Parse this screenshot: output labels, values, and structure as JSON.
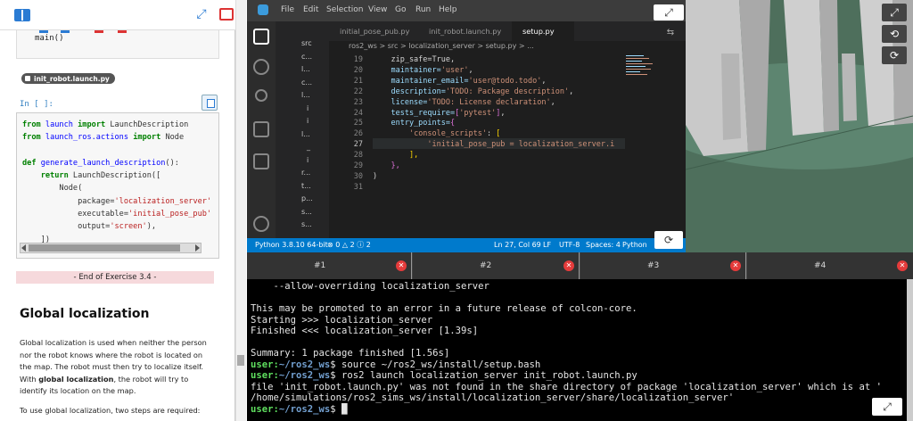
{
  "left_panel": {
    "top_icons": [
      "book-icon",
      "expand-icon",
      "slides-icon"
    ],
    "fragment_code": "main()",
    "file_tag": "init_robot.launch.py",
    "in_prompt": "In [ ]:",
    "code_lines": [
      [
        {
          "t": "from",
          "c": "kw"
        },
        {
          "t": " "
        },
        {
          "t": "launch",
          "c": "fn"
        },
        {
          "t": " "
        },
        {
          "t": "import",
          "c": "kw"
        },
        {
          "t": " LaunchDescription"
        }
      ],
      [
        {
          "t": "from",
          "c": "kw"
        },
        {
          "t": " "
        },
        {
          "t": "launch_ros.actions",
          "c": "fn"
        },
        {
          "t": " "
        },
        {
          "t": "import",
          "c": "kw"
        },
        {
          "t": " Node"
        }
      ],
      [
        {
          "t": ""
        }
      ],
      [
        {
          "t": "def",
          "c": "kw"
        },
        {
          "t": " "
        },
        {
          "t": "generate_launch_description",
          "c": "fn"
        },
        {
          "t": "():"
        }
      ],
      [
        {
          "t": "    "
        },
        {
          "t": "return",
          "c": "kw"
        },
        {
          "t": " LaunchDescription(["
        }
      ],
      [
        {
          "t": "        Node("
        }
      ],
      [
        {
          "t": "            package="
        },
        {
          "t": "'localization_server'",
          "c": "str"
        }
      ],
      [
        {
          "t": "            executable="
        },
        {
          "t": "'initial_pose_pub'",
          "c": "str"
        }
      ],
      [
        {
          "t": "            output="
        },
        {
          "t": "'screen'",
          "c": "str"
        },
        {
          "t": "),"
        }
      ],
      [
        {
          "t": "    ])"
        }
      ]
    ],
    "end_exercise": "- End of Exercise 3.4 -",
    "heading": "Global localization",
    "paragraph_parts": [
      "Global localization is used when neither the person nor the robot knows where the robot is located on the map. The robot must then try to localize itself. With ",
      "global localization",
      ", the robot will try to identify its location on the map."
    ],
    "paragraph2": "To use global localization, two steps are required:"
  },
  "vscode": {
    "menu": [
      "File",
      "Edit",
      "Selection",
      "View",
      "Go",
      "Run",
      "Help"
    ],
    "tabs": [
      "initial_pose_pub.py",
      "init_robot.launch.py",
      "setup.py"
    ],
    "active_tab": "setup.py",
    "breadcrumb": "ros2_ws  >  src  >  localization_server  >  setup.py  >  ...",
    "tree": [
      "src",
      "c...",
      "l...",
      "c...",
      "l...",
      "i",
      "i",
      "l...",
      "_",
      "i",
      "r...",
      "t...",
      "p...",
      "s...",
      "s..."
    ],
    "line_numbers": [
      "19",
      "20",
      "21",
      "22",
      "23",
      "24",
      "25",
      "26",
      "27",
      "28",
      "29",
      "30",
      "31"
    ],
    "current_line": "27",
    "code": [
      [
        {
          "t": "    zip_safe=True,",
          "c": "ep"
        }
      ],
      [
        {
          "t": "    maintainer="
        },
        {
          "t": "'user'",
          "c": "es"
        },
        {
          "t": ",",
          "c": "ep"
        }
      ],
      [
        {
          "t": "    maintainer_email="
        },
        {
          "t": "'user@todo.todo'",
          "c": "es"
        },
        {
          "t": ",",
          "c": "ep"
        }
      ],
      [
        {
          "t": "    description="
        },
        {
          "t": "'TODO: Package description'",
          "c": "es"
        },
        {
          "t": ",",
          "c": "ep"
        }
      ],
      [
        {
          "t": "    license="
        },
        {
          "t": "'TODO: License declaration'",
          "c": "es"
        },
        {
          "t": ",",
          "c": "ep"
        }
      ],
      [
        {
          "t": "    tests_require="
        },
        {
          "t": "[",
          "c": "eb"
        },
        {
          "t": "'pytest'",
          "c": "es"
        },
        {
          "t": "]",
          "c": "eb"
        },
        {
          "t": ",",
          "c": "ep"
        }
      ],
      [
        {
          "t": "    entry_points="
        },
        {
          "t": "{",
          "c": "eb"
        }
      ],
      [
        {
          "t": "        "
        },
        {
          "t": "'console_scripts'",
          "c": "es"
        },
        {
          "t": ": ",
          "c": "ep"
        },
        {
          "t": "[",
          "c": "ey"
        }
      ],
      [
        {
          "t": "            "
        },
        {
          "t": "'initial_pose_pub = localization_server.i",
          "c": "es"
        }
      ],
      [
        {
          "t": "        "
        },
        {
          "t": "],",
          "c": "ey"
        }
      ],
      [
        {
          "t": "    "
        },
        {
          "t": "},",
          "c": "eb"
        }
      ],
      [
        {
          "t": ")",
          "c": "ep"
        }
      ],
      [
        {
          "t": ""
        }
      ]
    ],
    "status": {
      "python": "Python 3.8.10 64-bit",
      "problems": "⊗ 0 △ 2 ⓘ 2",
      "position": "Ln 27, Col 69",
      "eol": "LF",
      "encoding": "UTF-8",
      "spaces": "Spaces: 4",
      "language": "Python"
    }
  },
  "terminal_tabs": [
    "#1",
    "#2",
    "#3",
    "#4"
  ],
  "terminal_lines": [
    [
      {
        "t": "    --allow-overriding localization_server"
      }
    ],
    [
      {
        "t": ""
      }
    ],
    [
      {
        "t": "This may be promoted to an error in a future release of colcon-core."
      }
    ],
    [
      {
        "t": "Starting >>> localization_server"
      }
    ],
    [
      {
        "t": "Finished <<< localization_server [1.39s]"
      }
    ],
    [
      {
        "t": ""
      }
    ],
    [
      {
        "t": "Summary: 1 package finished [1.56s]"
      }
    ],
    [
      {
        "t": "user:",
        "c": "tu"
      },
      {
        "t": "~/ros2_ws",
        "c": "tb"
      },
      {
        "t": "$ source ~/ros2_ws/install/setup.bash"
      }
    ],
    [
      {
        "t": "user:",
        "c": "tu"
      },
      {
        "t": "~/ros2_ws",
        "c": "tb"
      },
      {
        "t": "$ ros2 launch localization_server init_robot.launch.py"
      }
    ],
    [
      {
        "t": "file 'init_robot.launch.py' was not found in the share directory of package 'localization_server' which is at '"
      }
    ],
    [
      {
        "t": "/home/simulations/ros2_sims_ws/install/localization_server/share/localization_server'"
      }
    ],
    [
      {
        "t": "user:",
        "c": "tu"
      },
      {
        "t": "~/ros2_ws",
        "c": "tb"
      },
      {
        "t": "$ "
      },
      {
        "t": "█",
        "c": "cursor"
      }
    ]
  ]
}
